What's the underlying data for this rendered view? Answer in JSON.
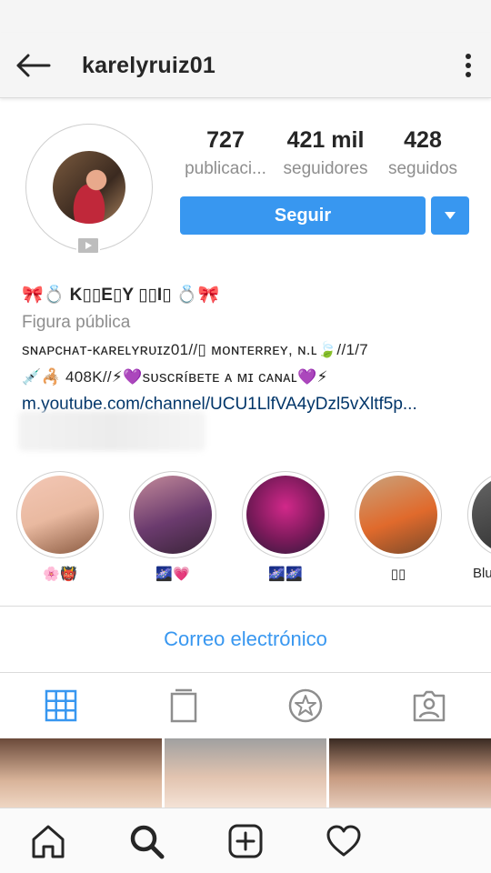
{
  "header": {
    "username": "karelyruiz01",
    "back_icon": "arrow-left-icon",
    "more_icon": "more-vertical-icon"
  },
  "profile": {
    "stats": {
      "posts": {
        "value": "727",
        "label": "publicaci..."
      },
      "followers": {
        "value": "421 mil",
        "label": "seguidores"
      },
      "following": {
        "value": "428",
        "label": "seguidos"
      }
    },
    "follow_label": "Seguir",
    "follow_dropdown_icon": "caret-down-icon",
    "igtv_icon": "play-icon"
  },
  "bio": {
    "name": "🎀💍 K▯▯E▯Y ▯▯I▯ 💍🎀",
    "category": "Figura pública",
    "line1": "ѕɴᴀᴘᴄʜᴀᴛ-ᴋᴀʀᴇʟʏʀᴜɪᴢ01//▯ ᴍᴏɴᴛᴇʀʀᴇʏ, ɴ.ʟ🍃//1/7",
    "line2": "💉🦂  408K//⚡💜ѕᴜѕᴄʀíʙᴇᴛᴇ ᴀ ᴍɪ ᴄᴀɴᴀʟ💜⚡",
    "link": "m.youtube.com/channel/UCU1LlfVA4yDzl5vXltf5p..."
  },
  "highlights": [
    {
      "label": "🌸👹",
      "color_a": "#e9b9a0",
      "color_b": "#f3c7b5"
    },
    {
      "label": "🌌💗",
      "color_a": "#6b3b6e",
      "color_b": "#c38a9a"
    },
    {
      "label": "🌌🌌",
      "color_a": "#d2288a",
      "color_b": "#2a1a3a"
    },
    {
      "label": "▯▯",
      "color_a": "#e06a2c",
      "color_b": "#c9a27c"
    },
    {
      "label": "Blu",
      "color_a": "#2c2c2c",
      "color_b": "#666666"
    }
  ],
  "email_label": "Correo electrónico",
  "tabs": [
    {
      "icon": "grid-icon",
      "active": true
    },
    {
      "icon": "igtv-icon",
      "active": false
    },
    {
      "icon": "star-circle-icon",
      "active": false
    },
    {
      "icon": "tagged-person-icon",
      "active": false
    }
  ],
  "bottom_nav": [
    {
      "icon": "home-icon"
    },
    {
      "icon": "search-icon"
    },
    {
      "icon": "add-post-icon"
    },
    {
      "icon": "heart-icon"
    }
  ],
  "colors": {
    "accent": "#3897f0",
    "muted": "#8e8e8e",
    "link": "#003569"
  }
}
